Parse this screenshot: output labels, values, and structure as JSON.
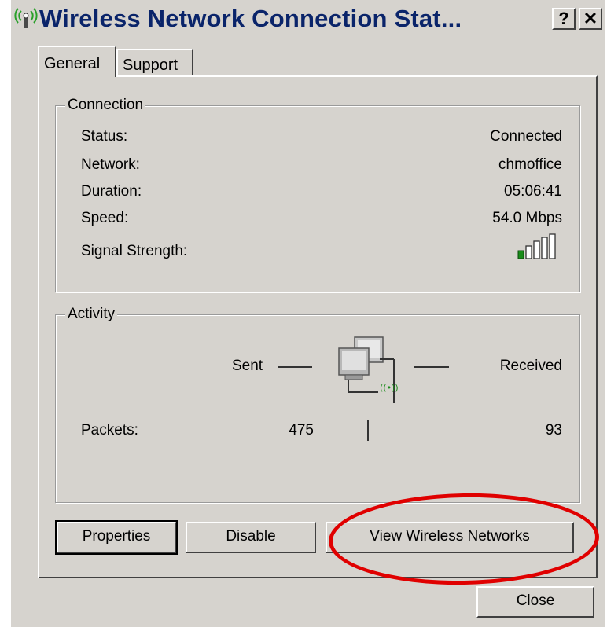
{
  "window": {
    "title": "Wireless Network Connection Stat...",
    "help_button": "?",
    "close_button": "✕"
  },
  "tabs": [
    {
      "label": "General",
      "active": true
    },
    {
      "label": "Support",
      "active": false
    }
  ],
  "connection": {
    "group_label": "Connection",
    "rows": [
      {
        "label": "Status:",
        "value": "Connected"
      },
      {
        "label": "Network:",
        "value": "chmoffice"
      },
      {
        "label": "Duration:",
        "value": "05:06:41"
      },
      {
        "label": "Speed:",
        "value": "54.0 Mbps"
      }
    ],
    "signal_label": "Signal Strength:",
    "signal_bars_level": 1
  },
  "activity": {
    "group_label": "Activity",
    "sent_label": "Sent",
    "received_label": "Received",
    "packets_label": "Packets:",
    "packets_sent": "475",
    "packets_received": "93"
  },
  "buttons": {
    "properties": "Properties",
    "disable": "Disable",
    "view_wireless": "View Wireless Networks",
    "close": "Close"
  },
  "colors": {
    "dialog_bg": "#d6d3ce",
    "title_text": "#0a246a",
    "signal_green": "#1a8c1a",
    "annotation_red": "#e00000"
  },
  "icons": {
    "title": "wireless-signal-icon",
    "activity": "network-computers-icon",
    "signal": "signal-strength-icon"
  }
}
